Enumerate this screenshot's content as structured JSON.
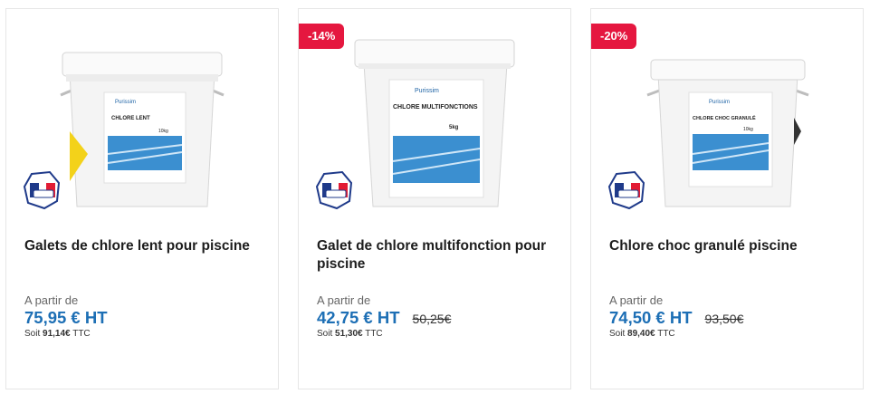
{
  "products": [
    {
      "title": "Galets de chlore lent pour piscine",
      "discount": "",
      "from_label": "A partir de",
      "price_ht": "75,95 € HT",
      "old_price": "",
      "ttc_prefix": "Soit",
      "ttc_value": "91,14€",
      "ttc_suffix": "TTC",
      "label_brand": "Purissim",
      "label_product": "CHLORE LENT",
      "label_weight": "10kg",
      "image": "white-bucket-with-blue-pool-label",
      "logo": "fabrique-en-france-flag-icon"
    },
    {
      "title": "Galet de chlore multifonction pour piscine",
      "discount": "-14%",
      "from_label": "A partir de",
      "price_ht": "42,75 € HT",
      "old_price": "50,25€",
      "ttc_prefix": "Soit",
      "ttc_value": "51,30€",
      "ttc_suffix": "TTC",
      "label_brand": "Purissim",
      "label_product": "CHLORE MULTIFONCTIONS",
      "label_weight": "5kg",
      "image": "white-bucket-with-blue-pool-label",
      "logo": "fabrique-en-france-flag-icon"
    },
    {
      "title": "Chlore choc granulé piscine",
      "discount": "-20%",
      "from_label": "A partir de",
      "price_ht": "74,50 € HT",
      "old_price": "93,50€",
      "ttc_prefix": "Soit",
      "ttc_value": "89,40€",
      "ttc_suffix": "TTC",
      "label_brand": "Purissim",
      "label_product": "CHLORE CHOC GRANULÉ",
      "label_weight": "10kg",
      "image": "white-bucket-with-blue-pool-label",
      "logo": "fabrique-en-france-flag-icon"
    }
  ],
  "colors": {
    "price": "#1d6fb5",
    "badge": "#e5173f",
    "border": "#e6e6e6"
  }
}
